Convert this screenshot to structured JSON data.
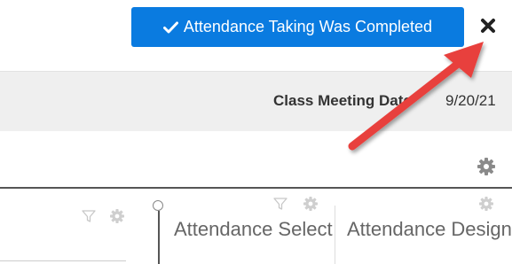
{
  "toast": {
    "message": "Attendance Taking Was Completed",
    "background_color": "#0a7be0",
    "text_color": "#ffffff",
    "icon": "check-icon"
  },
  "close_button": {
    "icon": "close-icon"
  },
  "class_meeting": {
    "label": "Class Meeting Date",
    "value": "9/20/21"
  },
  "toolbar": {
    "settings_icon": "gear-icon"
  },
  "columns": [
    {
      "icons": [
        "filter-icon",
        "gear-icon"
      ]
    },
    {
      "header": "Attendance Selection",
      "icons": [
        "filter-icon",
        "gear-icon"
      ]
    },
    {
      "header": "Attendance Designation",
      "icons": [
        "gear-icon"
      ]
    }
  ],
  "annotation": {
    "arrow_color": "#e8413c",
    "points_to": "close-button"
  }
}
